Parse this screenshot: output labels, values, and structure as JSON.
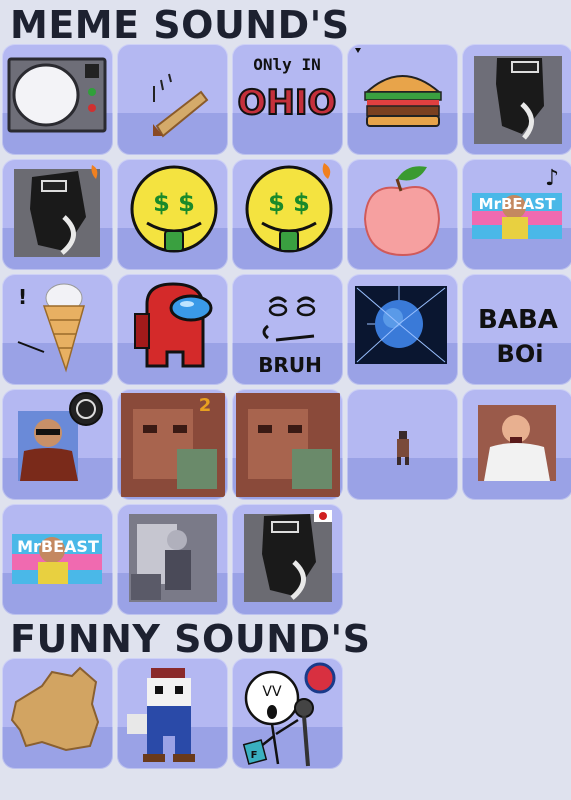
{
  "sections": [
    {
      "title": "MEME SOUND'S"
    },
    {
      "title": "FUNNY SOUND'S"
    }
  ],
  "meme_tiles": [
    {
      "name": "tv-sound-button",
      "icon": "crt-tv-icon"
    },
    {
      "name": "pencil-drop-sound-button",
      "icon": "falling-stick-icon"
    },
    {
      "name": "only-in-ohio-sound-button",
      "icon": "ohio-text-icon",
      "text_top": "ONly IN",
      "text_main": "OHIO"
    },
    {
      "name": "burger-sound-button",
      "icon": "burger-icon"
    },
    {
      "name": "sneaker-photo-sound-button",
      "icon": "sneaker-photo-icon"
    },
    {
      "name": "sneaker-music-sound-button",
      "icon": "sneaker-photo-icon"
    },
    {
      "name": "money-face-sound-button",
      "icon": "money-face-icon",
      "eyes": "$ $"
    },
    {
      "name": "money-face-fire-sound-button",
      "icon": "money-face-icon",
      "eyes": "$ $"
    },
    {
      "name": "peach-sound-button",
      "icon": "peach-icon"
    },
    {
      "name": "mrbeast-music-sound-button",
      "icon": "mrbeast-photo-icon",
      "logo_text": "MrBEAST"
    },
    {
      "name": "ice-cream-sound-button",
      "icon": "ice-cream-icon",
      "mark": "!"
    },
    {
      "name": "among-us-sound-button",
      "icon": "among-us-icon"
    },
    {
      "name": "bruh-sound-button",
      "icon": "bruh-face-icon",
      "text": "BRUH"
    },
    {
      "name": "brain-sound-button",
      "icon": "brain-photo-icon"
    },
    {
      "name": "baba-boi-sound-button",
      "icon": "baba-boi-text-icon",
      "text_top": "BABA",
      "text_bottom": "BOi"
    },
    {
      "name": "sunglasses-man-sound-button",
      "icon": "sunglasses-man-icon"
    },
    {
      "name": "face-closeup-2-sound-button",
      "icon": "face-closeup-icon",
      "badge_text": "2"
    },
    {
      "name": "face-closeup-sound-button",
      "icon": "face-closeup-icon"
    },
    {
      "name": "tiny-figure-sound-button",
      "icon": "tiny-figure-icon"
    },
    {
      "name": "ronaldo-sound-button",
      "icon": "ronaldo-photo-icon"
    },
    {
      "name": "mrbeast-sound-button",
      "icon": "mrbeast-photo-icon",
      "logo_text": "MrBEAST"
    },
    {
      "name": "gray-photo-sound-button",
      "icon": "gray-photo-icon"
    },
    {
      "name": "sneaker-flag-sound-button",
      "icon": "sneaker-photo-icon"
    }
  ],
  "funny_tiles": [
    {
      "name": "map-shape-sound-button",
      "icon": "map-blob-icon"
    },
    {
      "name": "mario-skeleton-sound-button",
      "icon": "mario-skeleton-icon"
    },
    {
      "name": "singer-stickman-sound-button",
      "icon": "stickman-microphone-icon",
      "text": "VV",
      "card_text": "F"
    }
  ],
  "colors": {
    "background": "#dfe2ee",
    "tile_top": "#b4b8f2",
    "tile_bottom": "#9aa2e6",
    "title": "#1d2130"
  }
}
